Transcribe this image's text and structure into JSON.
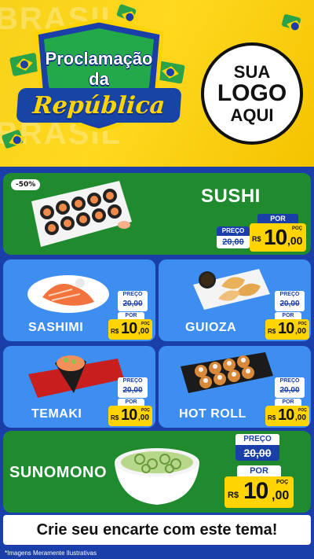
{
  "header": {
    "watermark": "BRASIL",
    "title_line1": "Proclamação",
    "title_line2": "da",
    "title_line3": "República",
    "logo_line1": "SUA",
    "logo_line2": "LOGO",
    "logo_line3": "AQUI"
  },
  "labels": {
    "preco": "PREÇO",
    "por": "POR",
    "currency": "R$",
    "unit": "POÇ"
  },
  "items": [
    {
      "name": "SUSHI",
      "discount_badge": "-50%",
      "old_price": "20,00",
      "new_price_int": "10",
      "new_price_cents": ",00"
    },
    {
      "name": "SASHIMI",
      "old_price": "20,00",
      "new_price_int": "10",
      "new_price_cents": ",00"
    },
    {
      "name": "GUIOZA",
      "old_price": "20,00",
      "new_price_int": "10",
      "new_price_cents": ",00"
    },
    {
      "name": "TEMAKI",
      "old_price": "20,00",
      "new_price_int": "10",
      "new_price_cents": ",00"
    },
    {
      "name": "HOT ROLL",
      "old_price": "20,00",
      "new_price_int": "10",
      "new_price_cents": ",00"
    },
    {
      "name": "SUNOMONO",
      "old_price": "20,00",
      "new_price_int": "10",
      "new_price_cents": ",00"
    }
  ],
  "cta": "Crie seu encarte com este tema!",
  "footer_note": "*Imagens Meramente Ilustrativas",
  "colors": {
    "green": "#1f8a2e",
    "blue": "#3d8ef0",
    "navy": "#1a3fa8",
    "yellow": "#ffd400"
  }
}
